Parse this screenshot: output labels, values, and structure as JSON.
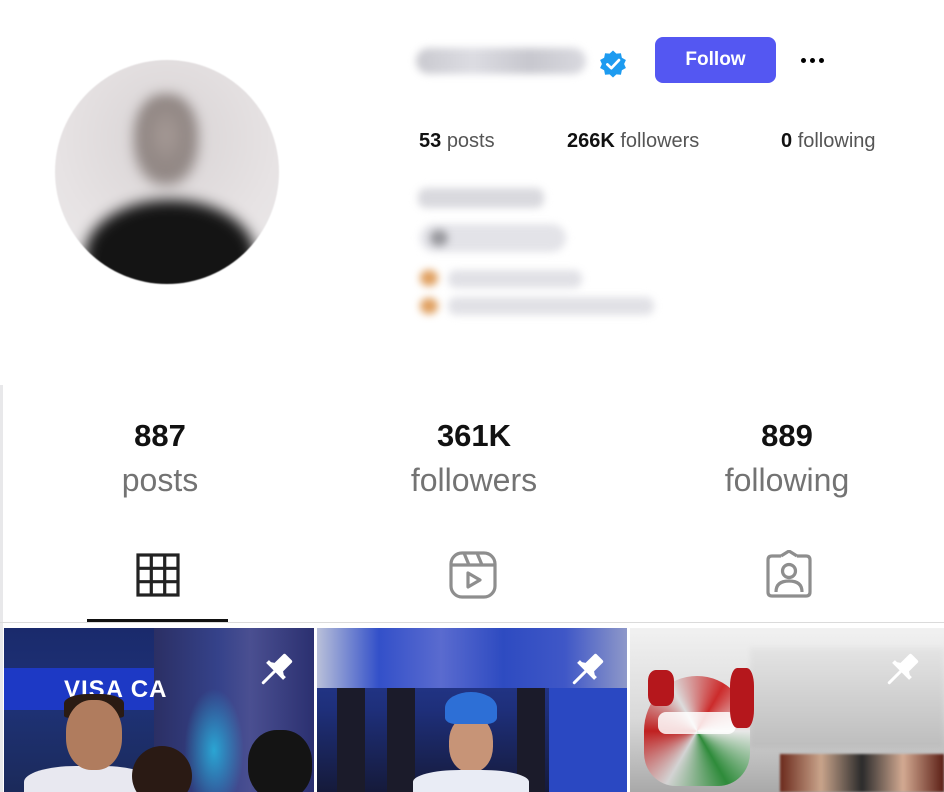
{
  "header": {
    "follow_label": "Follow",
    "stats": [
      {
        "count": "53",
        "label": "posts"
      },
      {
        "count": "266K",
        "label": "followers"
      },
      {
        "count": "0",
        "label": "following"
      }
    ]
  },
  "profile_stats": [
    {
      "count": "887",
      "label": "posts"
    },
    {
      "count": "361K",
      "label": "followers"
    },
    {
      "count": "889",
      "label": "following"
    }
  ],
  "tabs": [
    {
      "icon": "grid-icon",
      "active": true
    },
    {
      "icon": "reels-icon",
      "active": false
    },
    {
      "icon": "tagged-icon",
      "active": false
    }
  ],
  "posts": [
    {
      "pinned": true,
      "banner_text": "VISA CA"
    },
    {
      "pinned": true
    },
    {
      "pinned": true
    }
  ],
  "colors": {
    "follow_button": "#5457f2",
    "verified_badge": "#1d9bf0",
    "muted_text": "#737373"
  }
}
